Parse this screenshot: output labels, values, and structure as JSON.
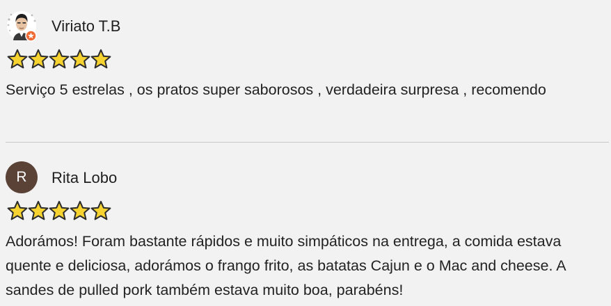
{
  "reviews": [
    {
      "author": "Viriato T.B",
      "avatar_type": "photo-icon",
      "rating": 5,
      "rating_max": 5,
      "text": "Serviço 5 estrelas , os pratos super saborosos , verdadeira surpresa , recomendo"
    },
    {
      "author": "Rita Lobo",
      "avatar_type": "letter",
      "avatar_letter": "R",
      "avatar_color": "#5b4237",
      "rating": 5,
      "rating_max": 5,
      "text": "Adorámos! Foram bastante rápidos e muito simpáticos na entrega, a comida estava quente e deliciosa, adorámos o frango frito, as batatas Cajun e o Mac and cheese. A sandes de pulled pork também estava muito boa, parabéns!"
    }
  ],
  "colors": {
    "background": "#f2f2f2",
    "star_fill": "#f7d331",
    "star_outline": "#2b2b2b",
    "badge": "#f06a35",
    "divider": "#c8c8c8"
  },
  "icons": {
    "star": "star-icon",
    "badge": "local-guide-badge-icon"
  }
}
